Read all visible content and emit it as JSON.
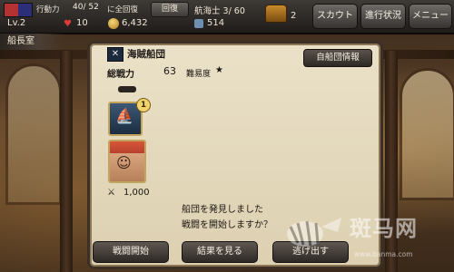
{
  "status": {
    "action_label": "行動力",
    "action_value": "40/ 52",
    "action_recover": "に全回復",
    "recover_button": "回復",
    "level": "Lv.2",
    "hearts": "10",
    "gold": "6,432",
    "navigator": "航海士 3/ 60",
    "crew": "514",
    "chest_count": "2"
  },
  "top_buttons": {
    "scout": "スカウト",
    "progress": "進行状況",
    "menu": "メニュー"
  },
  "room": "船長室",
  "dialog": {
    "fleet_name": "海賊船団",
    "power_label": "総戦力",
    "power_value": "63",
    "difficulty_label": "難易度",
    "difficulty_stars": "★",
    "info_button": "自船団情報",
    "badge": "1",
    "count": "1,000",
    "message_line1": "船団を発見しました",
    "message_line2": "戦闘を開始しますか？",
    "buttons": {
      "start": "戦闘開始",
      "view_result": "結果を見る",
      "flee": "逃げ出す"
    }
  },
  "watermark": {
    "site": "斑马网",
    "url": "www.banma.com"
  },
  "icons": [
    "flag-icon",
    "heart-icon",
    "coin-icon",
    "crew-icon",
    "chest-icon",
    "fleet-flag-icon",
    "star-icon",
    "cannon-icon",
    "ship-icon",
    "captain-face-icon",
    "sword-icon"
  ]
}
